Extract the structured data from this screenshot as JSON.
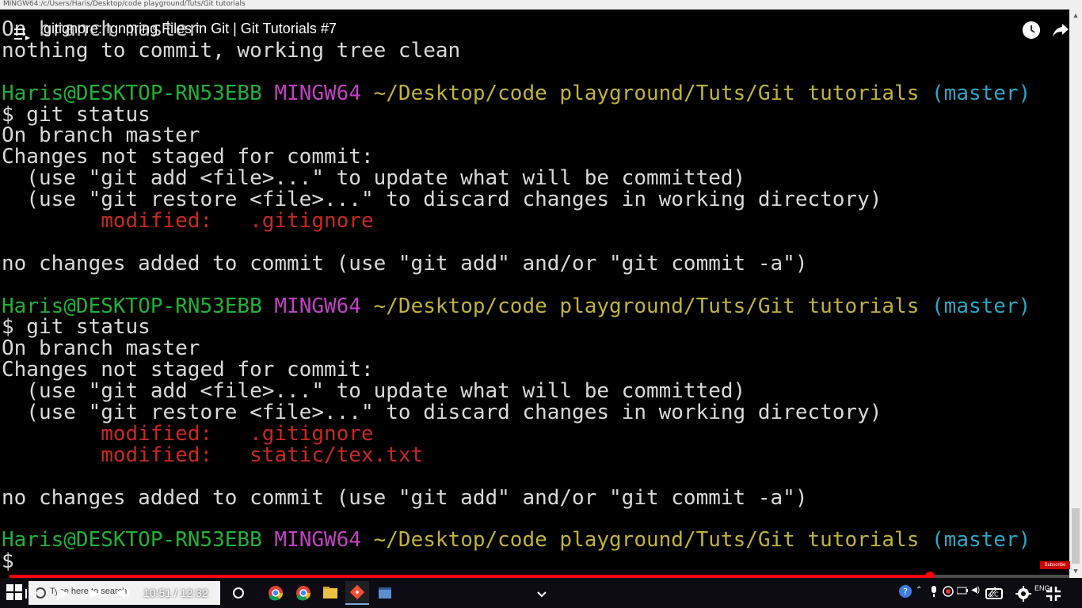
{
  "window": {
    "titlebar_text": "MINGW64:/c/Users/Haris/Desktop/code playground/Tuts/Git tutorials"
  },
  "video": {
    "title": ".gitignore: Ignoring Files in Git | Git Tutorials #7",
    "current_time": "10:51",
    "duration": "12:32",
    "time_display": "10:51 / 12:32",
    "progress_fraction": 0.8656,
    "subscribe_watermark": "Subscribe"
  },
  "terminal": {
    "lines": [
      [
        {
          "t": "On branch master",
          "c": ""
        }
      ],
      [
        {
          "t": "nothing to commit, working tree clean",
          "c": ""
        }
      ],
      [],
      [
        {
          "t": "Haris@DESKTOP-RN53EBB",
          "c": "c-green"
        },
        {
          "t": " ",
          "c": ""
        },
        {
          "t": "MINGW64",
          "c": "c-magenta"
        },
        {
          "t": " ",
          "c": ""
        },
        {
          "t": "~/Desktop/code playground/Tuts/Git tutorials",
          "c": "c-yellow"
        },
        {
          "t": " ",
          "c": ""
        },
        {
          "t": "(master)",
          "c": "c-cyan"
        }
      ],
      [
        {
          "t": "$ git status",
          "c": ""
        }
      ],
      [
        {
          "t": "On branch master",
          "c": ""
        }
      ],
      [
        {
          "t": "Changes not staged for commit:",
          "c": ""
        }
      ],
      [
        {
          "t": "  (use \"git add <file>...\" to update what will be committed)",
          "c": ""
        }
      ],
      [
        {
          "t": "  (use \"git restore <file>...\" to discard changes in working directory)",
          "c": ""
        }
      ],
      [
        {
          "t": "        ",
          "c": ""
        },
        {
          "t": "modified:   .gitignore",
          "c": "c-red"
        }
      ],
      [],
      [
        {
          "t": "no changes added to commit (use \"git add\" and/or \"git commit -a\")",
          "c": ""
        }
      ],
      [],
      [
        {
          "t": "Haris@DESKTOP-RN53EBB",
          "c": "c-green"
        },
        {
          "t": " ",
          "c": ""
        },
        {
          "t": "MINGW64",
          "c": "c-magenta"
        },
        {
          "t": " ",
          "c": ""
        },
        {
          "t": "~/Desktop/code playground/Tuts/Git tutorials",
          "c": "c-yellow"
        },
        {
          "t": " ",
          "c": ""
        },
        {
          "t": "(master)",
          "c": "c-cyan"
        }
      ],
      [
        {
          "t": "$ git status",
          "c": ""
        }
      ],
      [
        {
          "t": "On branch master",
          "c": ""
        }
      ],
      [
        {
          "t": "Changes not staged for commit:",
          "c": ""
        }
      ],
      [
        {
          "t": "  (use \"git add <file>...\" to update what will be committed)",
          "c": ""
        }
      ],
      [
        {
          "t": "  (use \"git restore <file>...\" to discard changes in working directory)",
          "c": ""
        }
      ],
      [
        {
          "t": "        ",
          "c": ""
        },
        {
          "t": "modified:   .gitignore",
          "c": "c-red"
        }
      ],
      [
        {
          "t": "        ",
          "c": ""
        },
        {
          "t": "modified:   static/tex.txt",
          "c": "c-red"
        }
      ],
      [],
      [
        {
          "t": "no changes added to commit (use \"git add\" and/or \"git commit -a\")",
          "c": ""
        }
      ],
      [],
      [
        {
          "t": "Haris@DESKTOP-RN53EBB",
          "c": "c-green"
        },
        {
          "t": " ",
          "c": ""
        },
        {
          "t": "MINGW64",
          "c": "c-magenta"
        },
        {
          "t": " ",
          "c": ""
        },
        {
          "t": "~/Desktop/code playground/Tuts/Git tutorials",
          "c": "c-yellow"
        },
        {
          "t": " ",
          "c": ""
        },
        {
          "t": "(master)",
          "c": "c-cyan"
        }
      ],
      [
        {
          "t": "$",
          "c": ""
        }
      ]
    ]
  },
  "taskbar": {
    "search_placeholder": "Type here to search",
    "language": "ENG",
    "apps": [
      "chrome-icon",
      "chrome-icon",
      "file-explorer-icon",
      "git-bash-icon",
      "terminal-icon"
    ]
  },
  "colors": {
    "green": "#1fb13a",
    "magenta": "#c23fc3",
    "yellow": "#c0b33a",
    "cyan": "#2aa7c5",
    "red": "#c8281f",
    "youtube_red": "#ff0000"
  }
}
